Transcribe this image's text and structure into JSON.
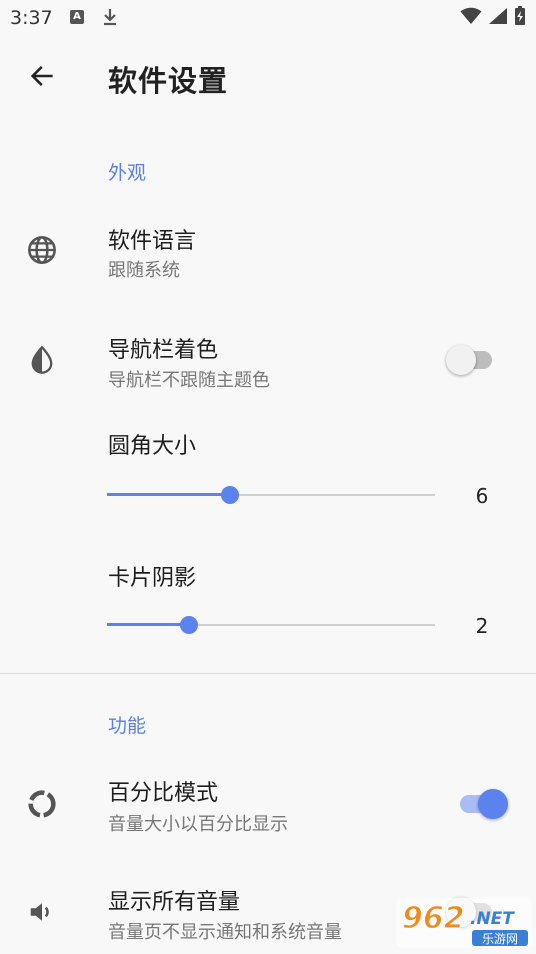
{
  "status_bar": {
    "time": "3:37",
    "notification_letter": "A"
  },
  "header": {
    "title": "软件设置"
  },
  "sections": {
    "appearance": {
      "label": "外观"
    },
    "features": {
      "label": "功能"
    }
  },
  "settings": {
    "language": {
      "title": "软件语言",
      "subtitle": "跟随系统"
    },
    "navbar_color": {
      "title": "导航栏着色",
      "subtitle": "导航栏不跟随主题色",
      "enabled": false
    },
    "corner_radius": {
      "title": "圆角大小",
      "value": "6",
      "fraction": 0.375
    },
    "card_shadow": {
      "title": "卡片阴影",
      "value": "2",
      "fraction": 0.25
    },
    "percent_mode": {
      "title": "百分比模式",
      "subtitle": "音量大小以百分比显示",
      "enabled": true
    },
    "show_all_volumes": {
      "title": "显示所有音量",
      "subtitle": "音量页不显示通知和系统音量",
      "enabled": false
    }
  },
  "watermark": {
    "line1": "962",
    "line1_suffix": ".NET",
    "line2": "乐游网"
  },
  "colors": {
    "accent": "#5b83ee",
    "section_header": "#5b7fe6",
    "background": "#f8f8f8"
  },
  "icons": {
    "back": "arrow-back-icon",
    "language": "globe-icon",
    "navbar_color": "contrast-drop-icon",
    "percent_mode": "donut-icon",
    "show_all_volumes": "volume-icon"
  }
}
